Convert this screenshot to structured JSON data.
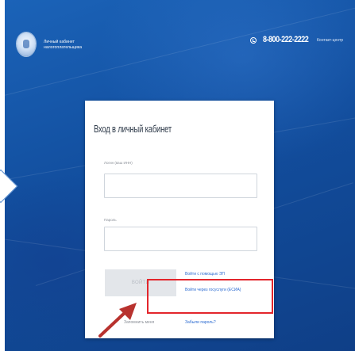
{
  "header": {
    "brand_line1": "Личный кабинет",
    "brand_line2": "налогоплательщика",
    "phone_number": "8-800-222-2222",
    "contact_center": "Контакт-центр"
  },
  "login_card": {
    "title": "Вход в личный кабинет",
    "login_label": "Логин (ваш ИНН)",
    "login_value": "",
    "password_label": "Пароль",
    "password_value": "",
    "login_button": "ВОЙТИ",
    "link_ep": "Войти с помощью ЭП",
    "link_esia": "Войти через госуслуги (ЕСИА)",
    "remember_me": "Запомнить меня",
    "forgot_password": "Забыли пароль?"
  },
  "colors": {
    "background": "#1a5fb4",
    "link": "#2c6bd1",
    "highlight": "#e3262c",
    "annotation_arrow": "#b8322e"
  },
  "icons": {
    "emblem": "fns-emblem-icon",
    "phone": "phone-icon",
    "arrow": "annotation-arrow-icon"
  }
}
